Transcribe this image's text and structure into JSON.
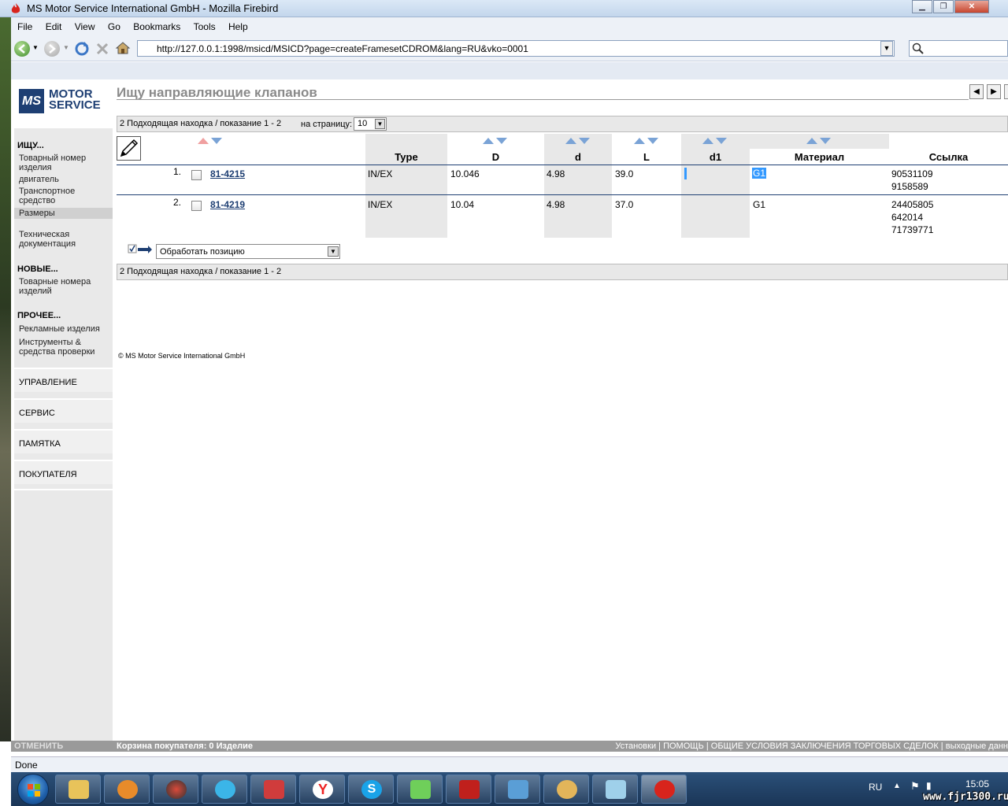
{
  "window": {
    "title": "MS Motor Service International GmbH - Mozilla Firebird"
  },
  "menu": {
    "items": [
      "File",
      "Edit",
      "View",
      "Go",
      "Bookmarks",
      "Tools",
      "Help"
    ]
  },
  "navbar": {
    "url": "http://127.0.0.1:1998/msicd/MSICD?page=createFramesetCDROM&lang=RU&vko=0001"
  },
  "logo": {
    "mark": "MS",
    "line1": "MOTOR",
    "line2": "SERVICE"
  },
  "sidebar": {
    "search_header": "ИЩУ...",
    "search_items": [
      "Товарный номер изделия",
      "двигатель",
      "Транспортное средство",
      "Размеры",
      "Техническая документация"
    ],
    "new_header": "НОВЫЕ...",
    "new_items": [
      "Товарные номера изделий"
    ],
    "other_header": "ПРОЧЕЕ...",
    "other_items": [
      "Рекламные изделия",
      "Инструменты & средства проверки"
    ],
    "boxes": [
      "УПРАВЛЕНИЕ",
      "СЕРВИС",
      "ПАМЯТКА",
      "ПОКУПАТЕЛЯ"
    ]
  },
  "main": {
    "title": "Ищу направляющие клапанов",
    "results_text": "2 Подходящая находка / показание 1 - 2",
    "per_page_label": "на страницу:",
    "per_page_value": "10",
    "columns": [
      "Type",
      "D",
      "d",
      "L",
      "d1",
      "Материал",
      "Ссылка"
    ],
    "rows": [
      {
        "num": "1.",
        "part": "81-4215",
        "type": "IN/EX",
        "D": "10.046",
        "d": "4.98",
        "L": "39.0",
        "d1": "",
        "material": "G1",
        "refs": [
          "90531109",
          "9158589"
        ]
      },
      {
        "num": "2.",
        "part": "81-4219",
        "type": "IN/EX",
        "D": "10.04",
        "d": "4.98",
        "L": "37.0",
        "d1": "",
        "material": "G1",
        "refs": [
          "24405805",
          "642014",
          "71739771"
        ]
      }
    ],
    "action_select": "Обработать позицию",
    "copyright": "© MS Motor Service International GmbH"
  },
  "footer": {
    "cancel": "ОТМЕНИТЬ",
    "basket": "Корзина покупателя: 0 Изделие",
    "links": "Установки | ПОМОЩЬ | ОБЩИЕ УСЛОВИЯ ЗАКЛЮЧЕНИЯ ТОРГОВЫХ СДЕЛОК | выходные данн"
  },
  "status": {
    "text": "Done"
  },
  "taskbar": {
    "lang": "RU",
    "clock": "15:05",
    "watermark": "www.fjr1300.ru"
  },
  "colors": {
    "brand_blue": "#1e3f73",
    "selection": "#3399ff"
  }
}
